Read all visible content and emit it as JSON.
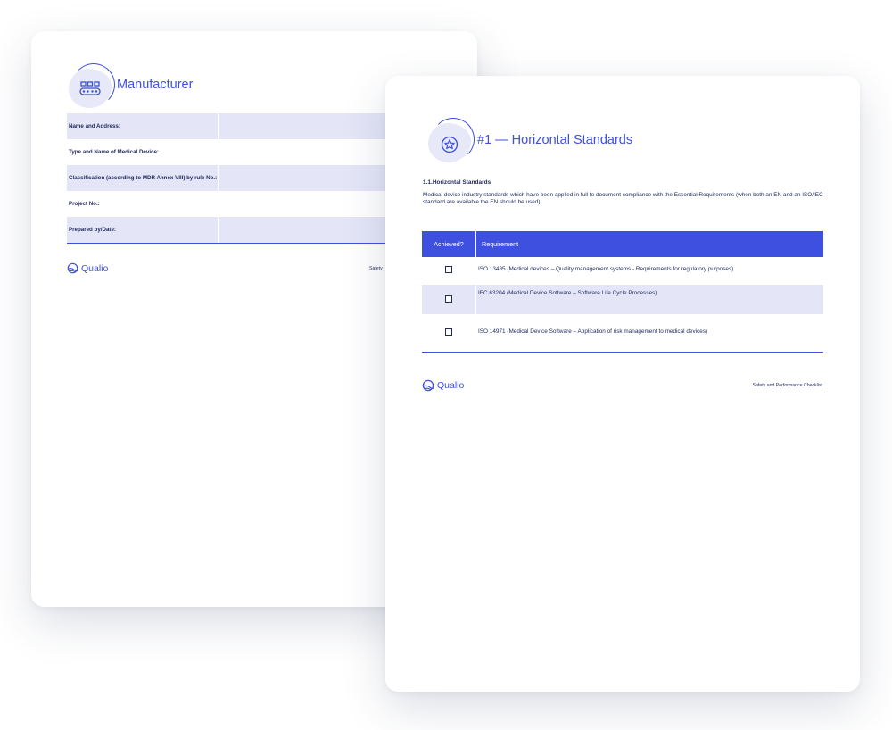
{
  "back_page": {
    "section_title": "Manufacturer",
    "section_icon": "conveyor-icon",
    "rows": [
      {
        "label": "Name and Address:",
        "value": ""
      },
      {
        "label": "Type and Name of Medical Device:",
        "value": ""
      },
      {
        "label": "Classification (according to MDR Annex VIII) by rule No.:",
        "value": ""
      },
      {
        "label": "Project No.:",
        "value": ""
      },
      {
        "label": "Prepared by/Date:",
        "value": ""
      }
    ],
    "logo_text": "Qualio",
    "footer_note": "Safety"
  },
  "front_page": {
    "section_title": "#1 — Horizontal Standards",
    "section_icon": "star-badge-icon",
    "sub_heading": "1.1.Horizontal Standards",
    "description": "Medical device industry standards which have been applied in full to document compliance with the Essential Requirements (when both an EN and an ISO/IEC standard are available the EN should be used).",
    "table": {
      "headers": [
        "Achieved?",
        "Requirement"
      ],
      "rows": [
        {
          "achieved": false,
          "requirement": "ISO 13485 (Medical devices – Quality management systems - Requirements for regulatory purposes)"
        },
        {
          "achieved": false,
          "requirement": "IEC 63204 (Medical Device Software – Software Life Cycle Processes)"
        },
        {
          "achieved": false,
          "requirement": "ISO 14971 (Medical Device Software – Application of risk management to medical devices)"
        }
      ]
    },
    "logo_text": "Qualio",
    "footer_note": "Safety and Performance Checklist"
  },
  "colors": {
    "accent": "#3d50e0",
    "row_shade": "#e4e5f7",
    "text": "#1f2a5a"
  }
}
